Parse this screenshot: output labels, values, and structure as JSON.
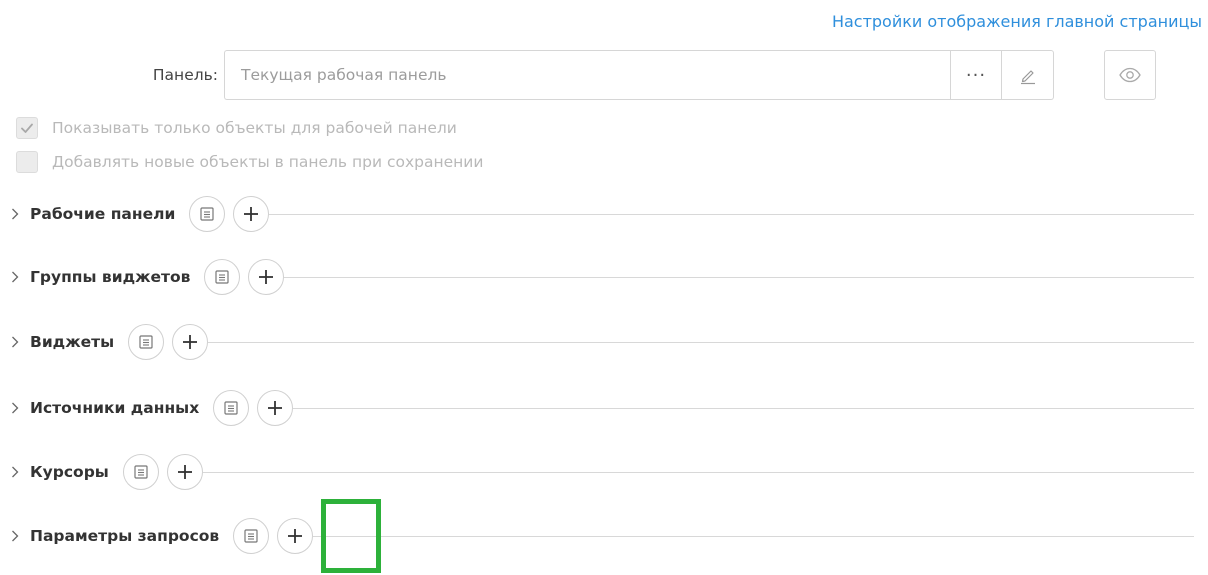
{
  "header": {
    "settings_link": "Настройки отображения главной страницы"
  },
  "panel": {
    "label": "Панель:",
    "value": "Текущая рабочая панель",
    "more_label": "···"
  },
  "options": [
    {
      "label": "Показывать только объекты для рабочей панели",
      "checked": true
    },
    {
      "label": "Добавлять новые объекты в панель при сохранении",
      "checked": false
    }
  ],
  "sections": [
    {
      "title": "Рабочие панели"
    },
    {
      "title": "Группы виджетов"
    },
    {
      "title": "Виджеты"
    },
    {
      "title": "Источники данных"
    },
    {
      "title": "Курсоры"
    },
    {
      "title": "Параметры запросов"
    }
  ],
  "colors": {
    "link": "#2f8fdc",
    "highlight": "#2db13a"
  }
}
